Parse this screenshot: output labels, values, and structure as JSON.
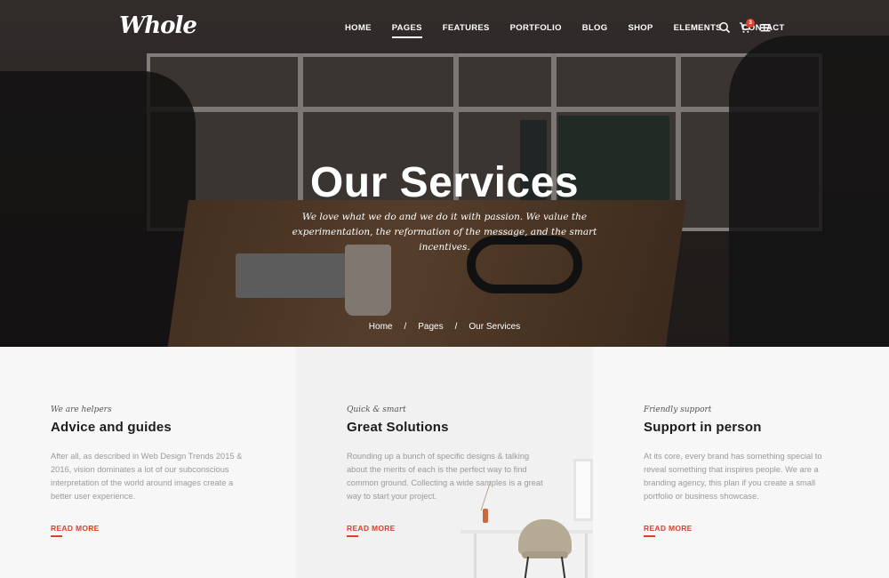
{
  "brand": {
    "logo_text": "Whole"
  },
  "nav": {
    "items": [
      {
        "label": "HOME"
      },
      {
        "label": "PAGES"
      },
      {
        "label": "FEATURES"
      },
      {
        "label": "PORTFOLIO"
      },
      {
        "label": "BLOG"
      },
      {
        "label": "SHOP"
      },
      {
        "label": "ELEMENTS"
      },
      {
        "label": "CONTACT"
      }
    ],
    "active": "PAGES",
    "cart_count": "3",
    "icons": [
      "search-icon",
      "cart-icon",
      "hamburger-menu-icon"
    ]
  },
  "hero": {
    "title": "Our Services",
    "subtitle": "We love what we do and we do it with passion. We value the experimentation, the reformation of the message, and the smart incentives."
  },
  "breadcrumb": {
    "items": [
      "Home",
      "Pages",
      "Our Services"
    ],
    "separator": "/"
  },
  "services": [
    {
      "tag": "We are helpers",
      "title": "Advice and guides",
      "text": "After all, as described in Web Design Trends 2015 & 2016, vision dominates a lot of our subconscious interpretation of the world around images create a better user experience.",
      "link": "READ MORE"
    },
    {
      "tag": "Quick & smart",
      "title": "Great Solutions",
      "text": "Rounding up a bunch of specific designs & talking about the merits of each is the perfect way to find common ground. Collecting a wide samples is a great way to start your project.",
      "link": "READ MORE"
    },
    {
      "tag": "Friendly support",
      "title": "Support in person",
      "text": "At its core, every brand has something special to reveal something that inspires people. We are a branding agency, this plan if you create a small portfolio or business showcase.",
      "link": "READ MORE"
    }
  ],
  "colors": {
    "accent": "#d9412a",
    "badge": "#e3402b",
    "hero_text": "#ffffff"
  }
}
